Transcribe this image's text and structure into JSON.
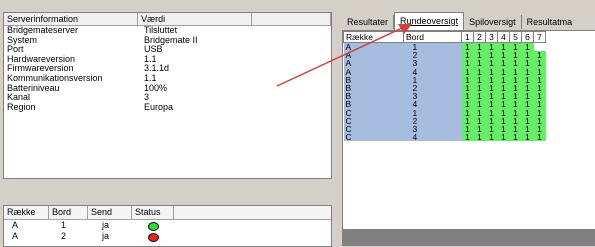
{
  "server_info": {
    "headers": [
      "Serverinformation",
      "Værdi",
      ""
    ],
    "rows": [
      {
        "key": "Bridgemateserver",
        "value": "Tilsluttet"
      },
      {
        "key": "System",
        "value": "Bridgemate II"
      },
      {
        "key": "Port",
        "value": "USB"
      },
      {
        "key": "Hardwareversion",
        "value": "1.1"
      },
      {
        "key": "Firmwareversion",
        "value": "3.1.1d"
      },
      {
        "key": "Kommunikationsversion",
        "value": "1.1"
      },
      {
        "key": "Batteriniveau",
        "value": "100%"
      },
      {
        "key": "Kanal",
        "value": "3"
      },
      {
        "key": "Region",
        "value": "Europa"
      }
    ]
  },
  "status_list": {
    "headers": [
      "Række",
      "Bord",
      "Send",
      "Status"
    ],
    "rows": [
      {
        "row": "A",
        "table": "1",
        "send": "ja",
        "status": "green"
      },
      {
        "row": "A",
        "table": "2",
        "send": "ja",
        "status": "red"
      }
    ],
    "status_colors": {
      "green": "#33dd33",
      "red": "#ee2222"
    }
  },
  "tabs": [
    {
      "label": "Resultater",
      "active": false
    },
    {
      "label": "Rundeoversigt",
      "active": true
    },
    {
      "label": "Spiloversigt",
      "active": false
    },
    {
      "label": "Resultatma",
      "active": false
    }
  ],
  "round_grid": {
    "headers": {
      "row": "Række",
      "table": "Bord",
      "rounds": [
        "1",
        "2",
        "3",
        "4",
        "5",
        "6",
        "7"
      ]
    },
    "rows": [
      {
        "row": "A",
        "table": "1",
        "cells": [
          1,
          1,
          1,
          1,
          1,
          1,
          null
        ]
      },
      {
        "row": "A",
        "table": "2",
        "cells": [
          1,
          1,
          1,
          1,
          1,
          1,
          1
        ]
      },
      {
        "row": "A",
        "table": "3",
        "cells": [
          1,
          1,
          1,
          1,
          1,
          1,
          1
        ]
      },
      {
        "row": "A",
        "table": "4",
        "cells": [
          1,
          1,
          1,
          1,
          1,
          1,
          1
        ]
      },
      {
        "row": "B",
        "table": "1",
        "cells": [
          1,
          1,
          1,
          1,
          1,
          1,
          1
        ]
      },
      {
        "row": "B",
        "table": "2",
        "cells": [
          1,
          1,
          1,
          1,
          1,
          1,
          1
        ]
      },
      {
        "row": "B",
        "table": "3",
        "cells": [
          1,
          1,
          1,
          1,
          1,
          1,
          1
        ]
      },
      {
        "row": "B",
        "table": "4",
        "cells": [
          1,
          1,
          1,
          1,
          1,
          1,
          1
        ]
      },
      {
        "row": "C",
        "table": "1",
        "cells": [
          1,
          1,
          1,
          1,
          1,
          1,
          1
        ]
      },
      {
        "row": "C",
        "table": "2",
        "cells": [
          1,
          1,
          1,
          1,
          1,
          1,
          1
        ]
      },
      {
        "row": "C",
        "table": "3",
        "cells": [
          1,
          1,
          1,
          1,
          1,
          1,
          1
        ]
      },
      {
        "row": "C",
        "table": "4",
        "cells": [
          1,
          1,
          1,
          1,
          1,
          1,
          1
        ]
      }
    ],
    "colors": {
      "key_cells": "#a7bde0",
      "done": "#66ee66"
    }
  },
  "annotation": {
    "arrow_color": "#d04040"
  }
}
